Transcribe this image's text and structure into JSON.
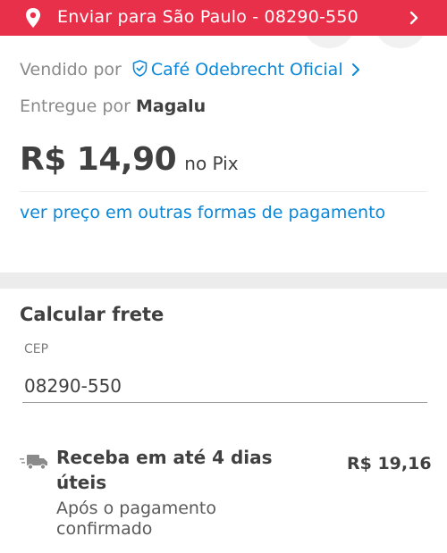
{
  "header": {
    "address_text": "Enviar para São Paulo - 08290-550",
    "pin_icon": "location-pin-icon",
    "chevron_icon": "chevron-right-icon",
    "background_color": "#e8304a"
  },
  "seller": {
    "sold_by_label": "Vendido por",
    "seller_name": "Café Odebrecht Oficial",
    "verified_icon": "shield-check-icon",
    "delivered_by_label": "Entregue por",
    "delivered_by_name": "Magalu"
  },
  "price": {
    "value": "R$ 14,90",
    "suffix": "no Pix",
    "other_payment_link": "ver preço em outras formas de pagamento"
  },
  "freight": {
    "title": "Calcular frete",
    "cep_label": "CEP",
    "cep_value": "08290-550",
    "option": {
      "icon": "delivery-truck-icon",
      "title": "Receba em até 4 dias úteis",
      "subtitle": "Após o pagamento confirmado",
      "price": "R$ 19,16"
    }
  },
  "colors": {
    "accent": "#e8304a",
    "link": "#0a87d8",
    "text": "#404040"
  }
}
